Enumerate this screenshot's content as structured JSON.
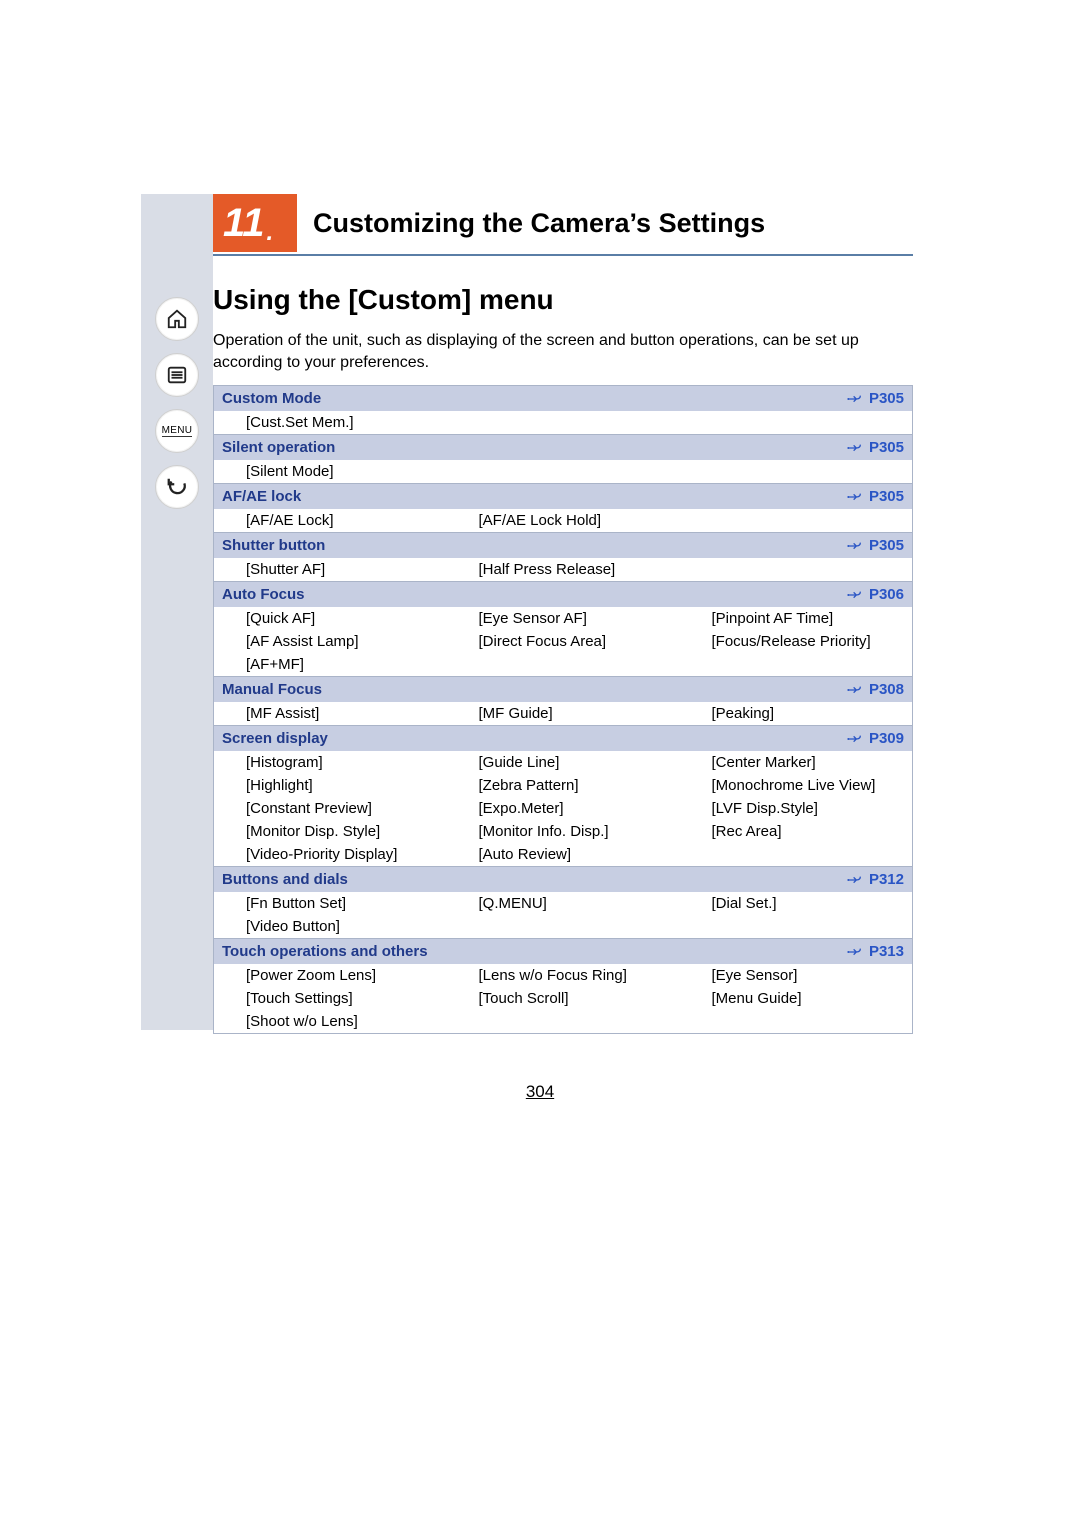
{
  "chapter": {
    "number": "11",
    "dot": ".",
    "title": "Customizing the Camera’s Settings"
  },
  "section_title": "Using the [Custom] menu",
  "intro": "Operation of the unit, such as displaying of the screen and button operations, can be set up according to your preferences.",
  "page_number": "304",
  "sidebar": {
    "menu_label": "MENU"
  },
  "groups": [
    {
      "title": "Custom Mode",
      "ref": "P305",
      "rows": [
        [
          "[Cust.Set Mem.]",
          "",
          ""
        ]
      ]
    },
    {
      "title": "Silent operation",
      "ref": "P305",
      "rows": [
        [
          "[Silent Mode]",
          "",
          ""
        ]
      ]
    },
    {
      "title": "AF/AE lock",
      "ref": "P305",
      "rows": [
        [
          "[AF/AE Lock]",
          "[AF/AE Lock Hold]",
          ""
        ]
      ]
    },
    {
      "title": "Shutter button",
      "ref": "P305",
      "rows": [
        [
          "[Shutter AF]",
          "[Half Press Release]",
          ""
        ]
      ]
    },
    {
      "title": "Auto Focus",
      "ref": "P306",
      "rows": [
        [
          "[Quick AF]",
          "[Eye Sensor AF]",
          "[Pinpoint AF Time]"
        ],
        [
          "[AF Assist Lamp]",
          "[Direct Focus Area]",
          "[Focus/Release Priority]"
        ],
        [
          "[AF+MF]",
          "",
          ""
        ]
      ]
    },
    {
      "title": "Manual Focus",
      "ref": "P308",
      "rows": [
        [
          "[MF Assist]",
          "[MF Guide]",
          "[Peaking]"
        ]
      ]
    },
    {
      "title": "Screen display",
      "ref": "P309",
      "rows": [
        [
          "[Histogram]",
          "[Guide Line]",
          "[Center Marker]"
        ],
        [
          "[Highlight]",
          "[Zebra Pattern]",
          "[Monochrome Live View]"
        ],
        [
          "[Constant Preview]",
          "[Expo.Meter]",
          "[LVF Disp.Style]"
        ],
        [
          "[Monitor Disp. Style]",
          "[Monitor Info. Disp.]",
          "[Rec Area]"
        ],
        [
          "[Video-Priority Display]",
          "[Auto Review]",
          ""
        ]
      ]
    },
    {
      "title": "Buttons and dials",
      "ref": "P312",
      "rows": [
        [
          "[Fn Button Set]",
          "[Q.MENU]",
          "[Dial Set.]"
        ],
        [
          "[Video Button]",
          "",
          ""
        ]
      ]
    },
    {
      "title": "Touch operations and others",
      "ref": "P313",
      "rows": [
        [
          "[Power Zoom Lens]",
          "[Lens w/o Focus Ring]",
          "[Eye Sensor]"
        ],
        [
          "[Touch Settings]",
          "[Touch Scroll]",
          "[Menu Guide]"
        ],
        [
          "[Shoot w/o Lens]",
          "",
          ""
        ]
      ]
    }
  ]
}
